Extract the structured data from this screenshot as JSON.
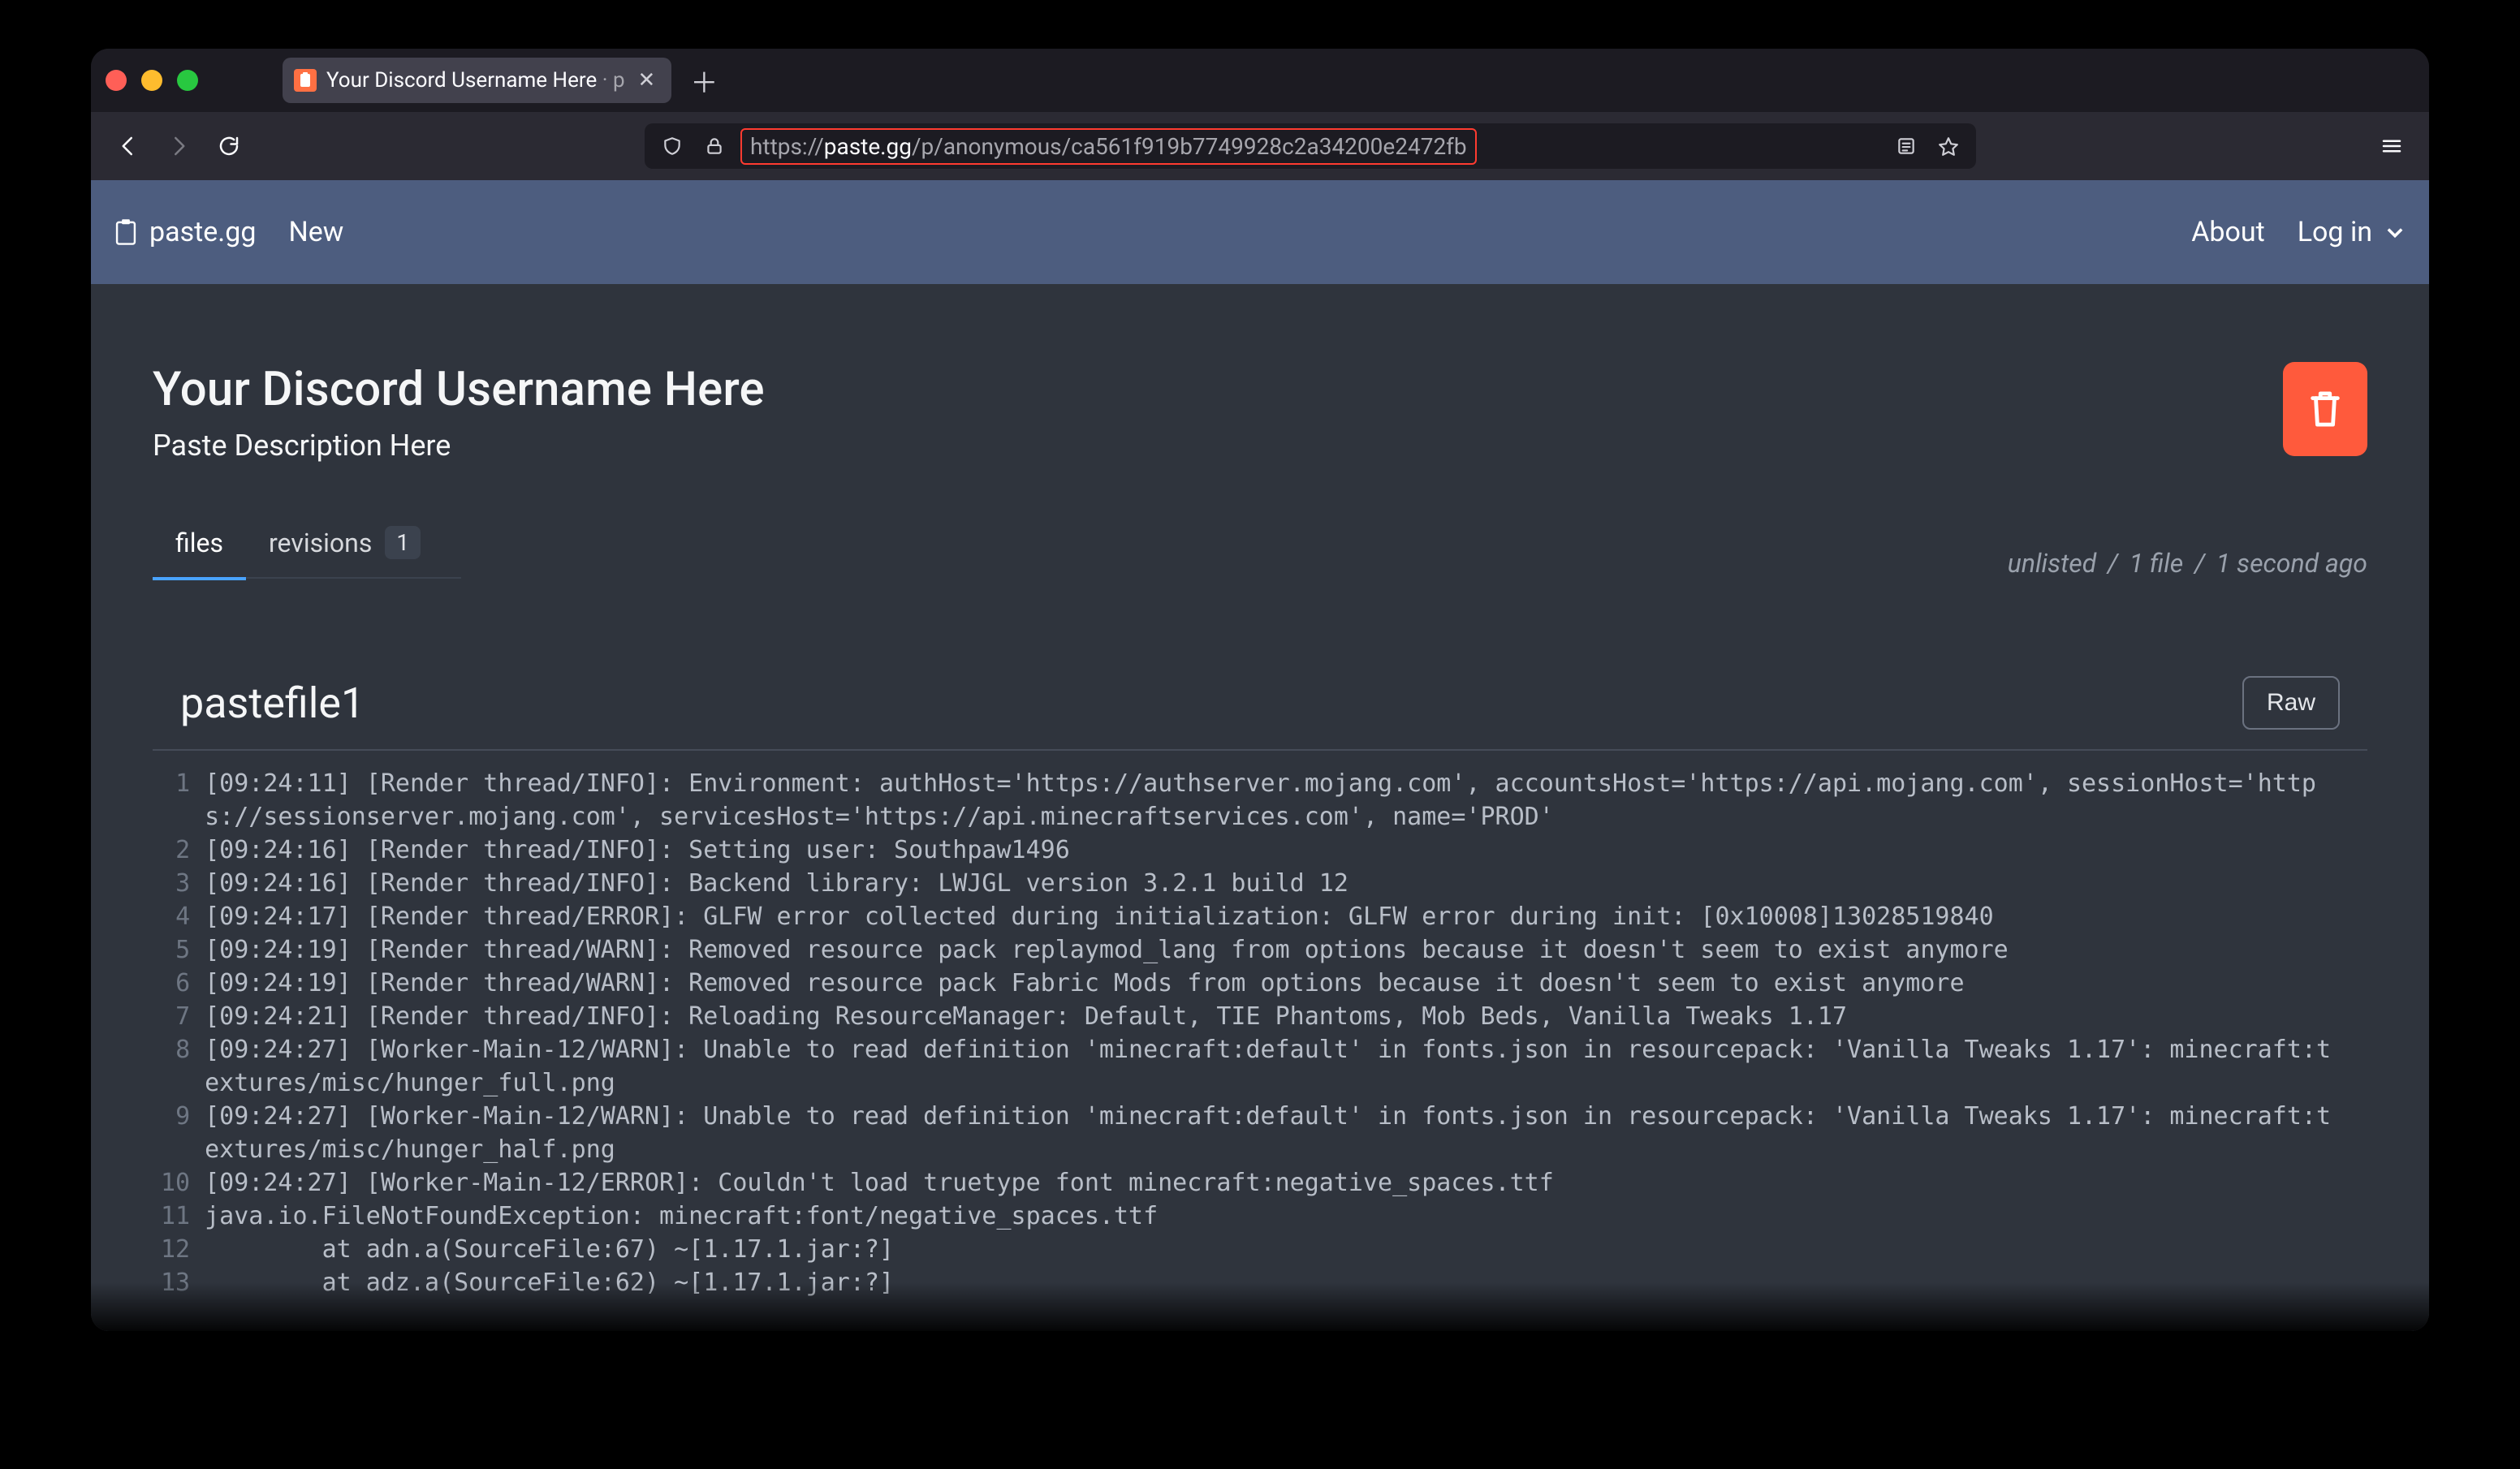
{
  "browser": {
    "tab_title_main": "Your Discord Username Here",
    "tab_title_suffix": " · p",
    "url_scheme": "https://",
    "url_host": "paste.gg",
    "url_path": "/p/anonymous/ca561f919b7749928c2a34200e2472fb"
  },
  "nav": {
    "brand": "paste.gg",
    "new": "New",
    "about": "About",
    "login": "Log in"
  },
  "paste": {
    "title": "Your Discord Username Here",
    "description": "Paste Description Here",
    "tab_files": "files",
    "tab_revisions": "revisions",
    "revisions_count": "1",
    "meta_visibility": "unlisted",
    "meta_files": "1 file",
    "meta_age": "1 second ago",
    "meta_sep": "/"
  },
  "file": {
    "name": "pastefile1",
    "raw_label": "Raw",
    "lines": [
      "[09:24:11] [Render thread/INFO]: Environment: authHost='https://authserver.mojang.com', accountsHost='https://api.mojang.com', sessionHost='https://sessionserver.mojang.com', servicesHost='https://api.minecraftservices.com', name='PROD'",
      "[09:24:16] [Render thread/INFO]: Setting user: Southpaw1496",
      "[09:24:16] [Render thread/INFO]: Backend library: LWJGL version 3.2.1 build 12",
      "[09:24:17] [Render thread/ERROR]: GLFW error collected during initialization: GLFW error during init: [0x10008]13028519840",
      "[09:24:19] [Render thread/WARN]: Removed resource pack replaymod_lang from options because it doesn't seem to exist anymore",
      "[09:24:19] [Render thread/WARN]: Removed resource pack Fabric Mods from options because it doesn't seem to exist anymore",
      "[09:24:21] [Render thread/INFO]: Reloading ResourceManager: Default, TIE Phantoms, Mob Beds, Vanilla Tweaks 1.17",
      "[09:24:27] [Worker-Main-12/WARN]: Unable to read definition 'minecraft:default' in fonts.json in resourcepack: 'Vanilla Tweaks 1.17': minecraft:textures/misc/hunger_full.png",
      "[09:24:27] [Worker-Main-12/WARN]: Unable to read definition 'minecraft:default' in fonts.json in resourcepack: 'Vanilla Tweaks 1.17': minecraft:textures/misc/hunger_half.png",
      "[09:24:27] [Worker-Main-12/ERROR]: Couldn't load truetype font minecraft:negative_spaces.ttf",
      "java.io.FileNotFoundException: minecraft:font/negative_spaces.ttf",
      "        at adn.a(SourceFile:67) ~[1.17.1.jar:?]",
      "        at adz.a(SourceFile:62) ~[1.17.1.jar:?]"
    ]
  }
}
